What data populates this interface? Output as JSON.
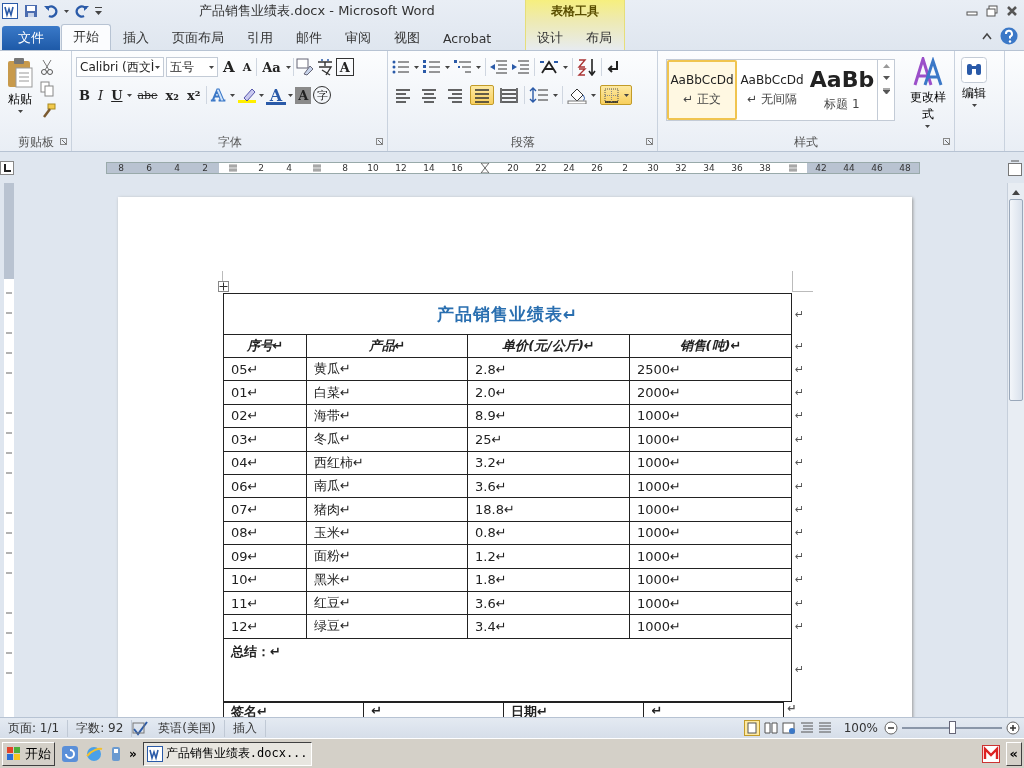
{
  "title_bar": {
    "title": "产品销售业绩表.docx - Microsoft Word",
    "context_group": "表格工具"
  },
  "tabs": [
    {
      "label": "文件",
      "kind": "file",
      "selected": false
    },
    {
      "label": "开始",
      "kind": "main",
      "selected": true
    },
    {
      "label": "插入",
      "kind": "main",
      "selected": false
    },
    {
      "label": "页面布局",
      "kind": "main",
      "selected": false
    },
    {
      "label": "引用",
      "kind": "main",
      "selected": false
    },
    {
      "label": "邮件",
      "kind": "main",
      "selected": false
    },
    {
      "label": "审阅",
      "kind": "main",
      "selected": false
    },
    {
      "label": "视图",
      "kind": "main",
      "selected": false
    },
    {
      "label": "Acrobat",
      "kind": "main",
      "selected": false
    },
    {
      "label": "设计",
      "kind": "context",
      "selected": false
    },
    {
      "label": "布局",
      "kind": "context",
      "selected": false
    }
  ],
  "ribbon": {
    "clipboard": {
      "paste": "粘贴",
      "label": "剪贴板"
    },
    "font": {
      "font_name": "Calibri (西文Ì",
      "font_size": "五号",
      "size_buttons": [
        "A",
        "A"
      ],
      "case_button": "Aa",
      "border_button": "A",
      "format_buttons": [
        {
          "label": "B",
          "kind": "bold"
        },
        {
          "label": "I",
          "kind": "italic"
        },
        {
          "label": "U",
          "kind": "underline"
        },
        {
          "label": "abe",
          "kind": "strike"
        },
        {
          "label": "x₂",
          "kind": "sub"
        },
        {
          "label": "x²",
          "kind": "sup"
        }
      ],
      "effect_button": "A",
      "color_button": "A",
      "shading_button": "A",
      "enclose_button": "字",
      "label": "字体"
    },
    "paragraph": {
      "align": [
        {
          "selected": false
        },
        {
          "selected": false
        },
        {
          "selected": false
        },
        {
          "selected": true
        },
        {
          "selected": false
        }
      ],
      "borders_selected": true,
      "label": "段落"
    },
    "styles": {
      "items": [
        {
          "preview": "AaBbCcDd",
          "name": "↵ 正文",
          "kind": "normal",
          "selected": true
        },
        {
          "preview": "AaBbCcDd",
          "name": "↵ 无间隔",
          "kind": "normal",
          "selected": false
        },
        {
          "preview": "AaBb",
          "name": "标题 1",
          "kind": "heading",
          "selected": false
        }
      ],
      "change": "更改样式",
      "label": "样式"
    },
    "editing": {
      "label": "编辑"
    }
  },
  "ruler": [
    {
      "label": "8"
    },
    {
      "label": "6"
    },
    {
      "label": "4"
    },
    {
      "label": "2"
    },
    {
      "kind": "marker"
    },
    {
      "label": "2"
    },
    {
      "label": "4"
    },
    {
      "kind": "marker"
    },
    {
      "label": "8"
    },
    {
      "label": "10"
    },
    {
      "label": "12"
    },
    {
      "label": "14"
    },
    {
      "label": "16"
    },
    {
      "kind": "indent"
    },
    {
      "label": "20"
    },
    {
      "label": "22"
    },
    {
      "label": "24"
    },
    {
      "label": "26"
    },
    {
      "label": "2"
    },
    {
      "label": "30"
    },
    {
      "label": "32"
    },
    {
      "label": "34"
    },
    {
      "label": "36"
    },
    {
      "label": "38"
    },
    {
      "kind": "marker"
    },
    {
      "label": "42"
    },
    {
      "label": "44"
    },
    {
      "label": "46"
    },
    {
      "label": "48"
    }
  ],
  "document": {
    "title": "产品销售业绩表↵",
    "title_end": "↵",
    "columns": [
      "序号↵",
      "产品↵",
      "单价(元/公斤)↵",
      "销售(吨)↵"
    ],
    "header_end": "↵",
    "rows": [
      {
        "cells": [
          "05↵",
          "黄瓜↵",
          "2.8↵",
          "2500↵"
        ],
        "end": "↵"
      },
      {
        "cells": [
          "01↵",
          "白菜↵",
          "2.0↵",
          "2000↵"
        ],
        "end": "↵"
      },
      {
        "cells": [
          "02↵",
          "海带↵",
          "8.9↵",
          "1000↵"
        ],
        "end": "↵"
      },
      {
        "cells": [
          "03↵",
          "冬瓜↵",
          "25↵",
          "1000↵"
        ],
        "end": "↵"
      },
      {
        "cells": [
          "04↵",
          "西红柿↵",
          "3.2↵",
          "1000↵"
        ],
        "end": "↵"
      },
      {
        "cells": [
          "06↵",
          "南瓜↵",
          "3.6↵",
          "1000↵"
        ],
        "end": "↵"
      },
      {
        "cells": [
          "07↵",
          "猪肉↵",
          "18.8↵",
          "1000↵"
        ],
        "end": "↵"
      },
      {
        "cells": [
          "08↵",
          "玉米↵",
          "0.8↵",
          "1000↵"
        ],
        "end": "↵"
      },
      {
        "cells": [
          "09↵",
          "面粉↵",
          "1.2↵",
          "1000↵"
        ],
        "end": "↵"
      },
      {
        "cells": [
          "10↵",
          "黑米↵",
          "1.8↵",
          "1000↵"
        ],
        "end": "↵"
      },
      {
        "cells": [
          "11↵",
          "红豆↵",
          "3.6↵",
          "1000↵"
        ],
        "end": "↵"
      },
      {
        "cells": [
          "12↵",
          "绿豆↵",
          "3.4↵",
          "1000↵"
        ],
        "end": "↵"
      }
    ],
    "summary": "总结：↵",
    "summary_end": "↵",
    "signature_row": [
      "签名↵",
      "↵",
      "日期↵",
      "↵"
    ],
    "signature_end": "↵"
  },
  "status_bar": {
    "items": [
      "页面: 1/1",
      "字数: 92",
      "英语(美国)",
      "插入"
    ],
    "zoom": "100%",
    "level": 0.5
  },
  "taskbar": {
    "start": "开始",
    "more": "»",
    "window": "产品销售业绩表.docx...",
    "tray": "«"
  }
}
